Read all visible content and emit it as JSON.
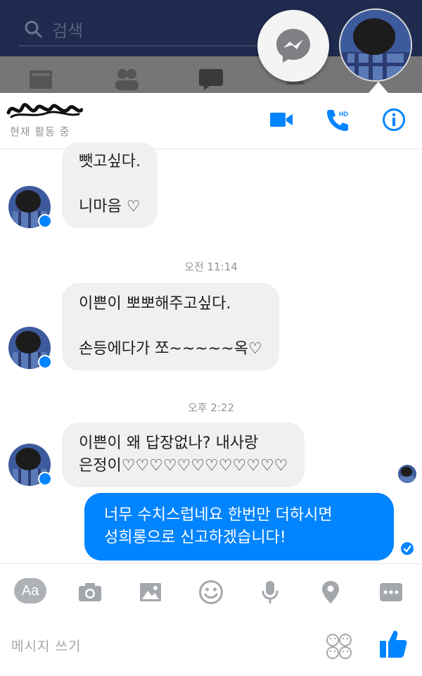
{
  "background": {
    "search_placeholder": "검색"
  },
  "header": {
    "contact_status": "현재 활동 중",
    "icons": [
      "video-call-icon",
      "hd-voice-call-icon",
      "info-icon"
    ],
    "hd_label": "HD"
  },
  "messages": [
    {
      "side": "in",
      "text": "뺏고싶다.\n\n니마음 ♡"
    },
    {
      "side": "time",
      "text": "오전 11:14"
    },
    {
      "side": "in",
      "text": "이쁜이 뽀뽀해주고싶다.\n\n손등에다가 쪼~~~~~옥♡"
    },
    {
      "side": "time",
      "text": "오후 2:22"
    },
    {
      "side": "in",
      "text": "이쁜이 왜 답장없나? 내사랑\n은정이♡♡♡♡♡♡♡♡♡♡♡♡"
    },
    {
      "side": "out",
      "text": "너무 수치스럽네요 한번만 더하시면\n성희롱으로 신고하겠습니다!"
    }
  ],
  "composer": {
    "aa_label": "Aa",
    "placeholder": "메시지 쓰기",
    "tools": [
      "text-style-button",
      "camera-icon",
      "gallery-icon",
      "emoji-icon",
      "microphone-icon",
      "location-icon",
      "more-icon"
    ]
  },
  "colors": {
    "accent": "#0084ff",
    "bubble_in": "#f1f0f0",
    "top_bar": "#1f2a4f"
  }
}
